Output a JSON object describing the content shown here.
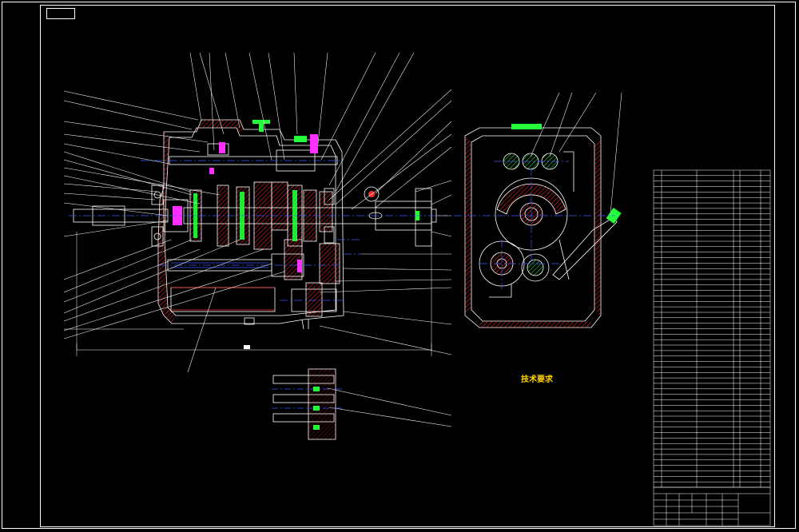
{
  "sheet": {
    "corner_tag": "",
    "title_block_name": "",
    "title_block_code": ""
  },
  "technical_requirements": {
    "title": "技术要求",
    "items": [
      "",
      "",
      "",
      "",
      "",
      "",
      "",
      "",
      ""
    ]
  },
  "colors": {
    "background": "#000000",
    "line": "#ffffff",
    "hatch_red": "#ff2a2a",
    "centerline_blue": "#3c5cff",
    "green_part": "#24ff3a",
    "magenta_part": "#ff30ff",
    "text_green": "#00ff00",
    "text_yellow": "#ffd200"
  },
  "icons": {
    "main_view": "gearbox-longitudinal-section",
    "side_view": "gearbox-cross-section",
    "detail_view": "shift-rail-detail",
    "parts_list": "bill-of-materials-table"
  }
}
